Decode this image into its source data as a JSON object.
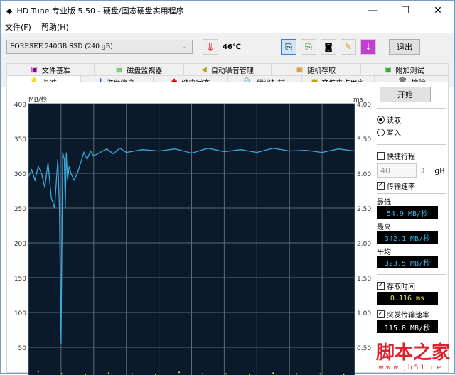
{
  "window": {
    "title": "HD Tune 专业版 5.50 - 硬盘/固态硬盘实用程序",
    "minimize": "—",
    "maximize": "☐",
    "close": "✕"
  },
  "menu": [
    "文件(F)",
    "帮助(H)"
  ],
  "toolbar": {
    "drive": "FORESEE 240GB SSD (240 gB)",
    "temperature": "46℃",
    "exit": "退出"
  },
  "tabs_top": [
    "文件基准",
    "磁盘监视器",
    "自动噪音管理",
    "随机存取",
    "附加测试"
  ],
  "tabs_bottom": [
    "基准",
    "磁盘信息",
    "健康状态",
    "错误扫描",
    "文件夹占用率",
    "擦除"
  ],
  "side": {
    "start": "开始",
    "read": "读取",
    "write": "写入",
    "short_stroke": "快捷行程",
    "stroke_value": "40",
    "stroke_unit": "gB",
    "transfer_rate": "传输速率",
    "min_label": "最低",
    "min": "54.9 MB/秒",
    "max_label": "最高",
    "max": "342.1 MB/秒",
    "avg_label": "平均",
    "avg": "323.5 MB/秒",
    "access_time": "存取时间",
    "access_value": "0.116 ms",
    "burst_rate": "突发传输速率",
    "burst_value": "115.8 MB/秒"
  },
  "watermark": {
    "title": "脚本之家",
    "url": "www.jb51.net"
  },
  "chart_data": {
    "type": "line",
    "ylabel": "MB/秒",
    "y2label": "ms",
    "ylim": [
      0,
      400
    ],
    "y2lim": [
      0,
      4
    ],
    "yticks": [
      "400",
      "350",
      "300",
      "250",
      "200",
      "150",
      "100",
      "50"
    ],
    "y2ticks": [
      "4.00",
      "3.50",
      "3.00",
      "2.50",
      "2.00",
      "1.50",
      "1.00",
      "0.50"
    ],
    "grid": true,
    "x_percent": [
      0,
      1,
      2,
      3,
      4,
      5,
      6,
      7,
      8,
      9,
      9.5,
      10,
      10.5,
      11,
      11.3,
      11.6,
      12,
      12.5,
      13,
      14,
      15,
      16,
      17,
      18,
      19,
      20,
      22,
      24,
      26,
      28,
      30,
      35,
      40,
      45,
      50,
      55,
      60,
      65,
      70,
      75,
      80,
      85,
      90,
      95,
      100
    ],
    "transfer": [
      295,
      305,
      290,
      310,
      300,
      280,
      315,
      265,
      250,
      320,
      250,
      55,
      330,
      320,
      250,
      330,
      290,
      310,
      300,
      290,
      300,
      315,
      330,
      320,
      332,
      325,
      330,
      335,
      328,
      336,
      330,
      334,
      332,
      335,
      329,
      336,
      331,
      334,
      330,
      336,
      332,
      333,
      330,
      335,
      332
    ],
    "access_ms": [
      0.15,
      0.12,
      0.11,
      0.13,
      0.12,
      0.11,
      0.14,
      0.12,
      0.12,
      0.11,
      0.13,
      0.12,
      0.12,
      0.11
    ]
  }
}
